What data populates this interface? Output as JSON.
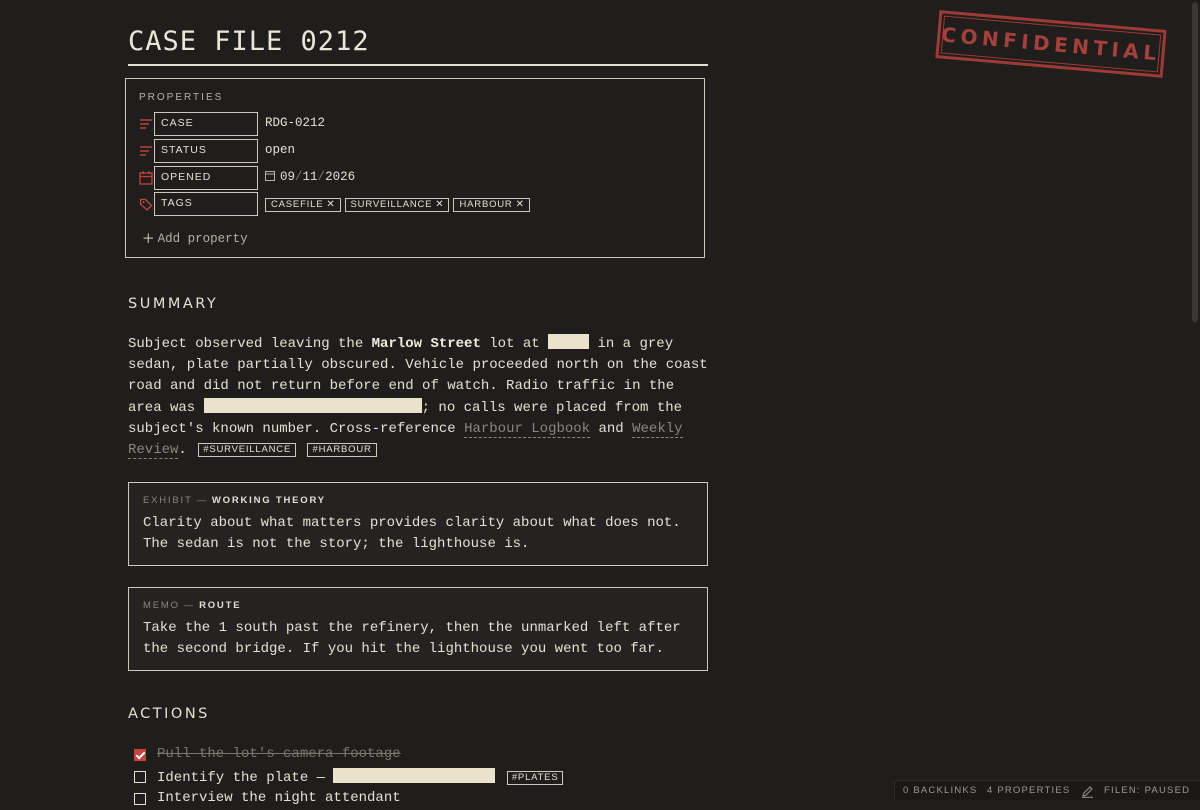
{
  "page": {
    "title": "CASE FILE 0212",
    "stamp": "CONFIDENTIAL"
  },
  "properties": {
    "heading": "PROPERTIES",
    "rows": [
      {
        "key": "CASE",
        "icon": "text-lines-icon",
        "value": "RDG-0212"
      },
      {
        "key": "STATUS",
        "icon": "text-lines-icon",
        "value": "open"
      },
      {
        "key": "OPENED",
        "icon": "calendar-icon",
        "value_parts": [
          "09",
          "11",
          "2026"
        ],
        "separator": "/"
      },
      {
        "key": "TAGS",
        "icon": "tags-icon",
        "tags": [
          "CASEFILE",
          "SURVEILLANCE",
          "HARBOUR"
        ]
      }
    ],
    "add_label": "Add property"
  },
  "summary": {
    "heading": "SUMMARY",
    "p1": "Subject observed leaving the ",
    "bold": "Marlow Street",
    "p2": " lot at ",
    "p3": " in a grey sedan, plate partially obscured. Vehicle proceeded north on the coast road and did not return before end of watch. Radio traffic in the area was ",
    "p4": "; no calls were placed from the subject's known number. Cross-reference ",
    "link1": "Harbour Logbook",
    "and": " and ",
    "link2": "Weekly Review",
    "period": ".",
    "tags": [
      "#SURVEILLANCE",
      "#HARBOUR"
    ]
  },
  "exhibit": {
    "label": "EXHIBIT",
    "dash": "—",
    "title": "WORKING THEORY",
    "body": "Clarity about what matters provides clarity about what does not. The sedan is not the story; the lighthouse is."
  },
  "memo": {
    "label": "MEMO",
    "dash": "—",
    "title": "ROUTE",
    "body": "Take the 1 south past the refinery, then the unmarked left after the second bridge. If you hit the lighthouse you went too far."
  },
  "actions": {
    "heading": "ACTIONS",
    "items": [
      {
        "text": "Pull the lot's camera footage",
        "done": true
      },
      {
        "text": "Identify the plate —",
        "done": false,
        "tag": "#PLATES"
      },
      {
        "text": "Interview the night attendant",
        "done": false
      }
    ]
  },
  "status_bar": {
    "backlinks": "0 BACKLINKS",
    "properties": "4 PROPERTIES",
    "sync": "FILEN: PAUSED"
  },
  "colors": {
    "background": "#1f1e1c",
    "text": "#e6e0d2",
    "accent_red": "#c8423b",
    "redaction": "#ebe2cc"
  }
}
